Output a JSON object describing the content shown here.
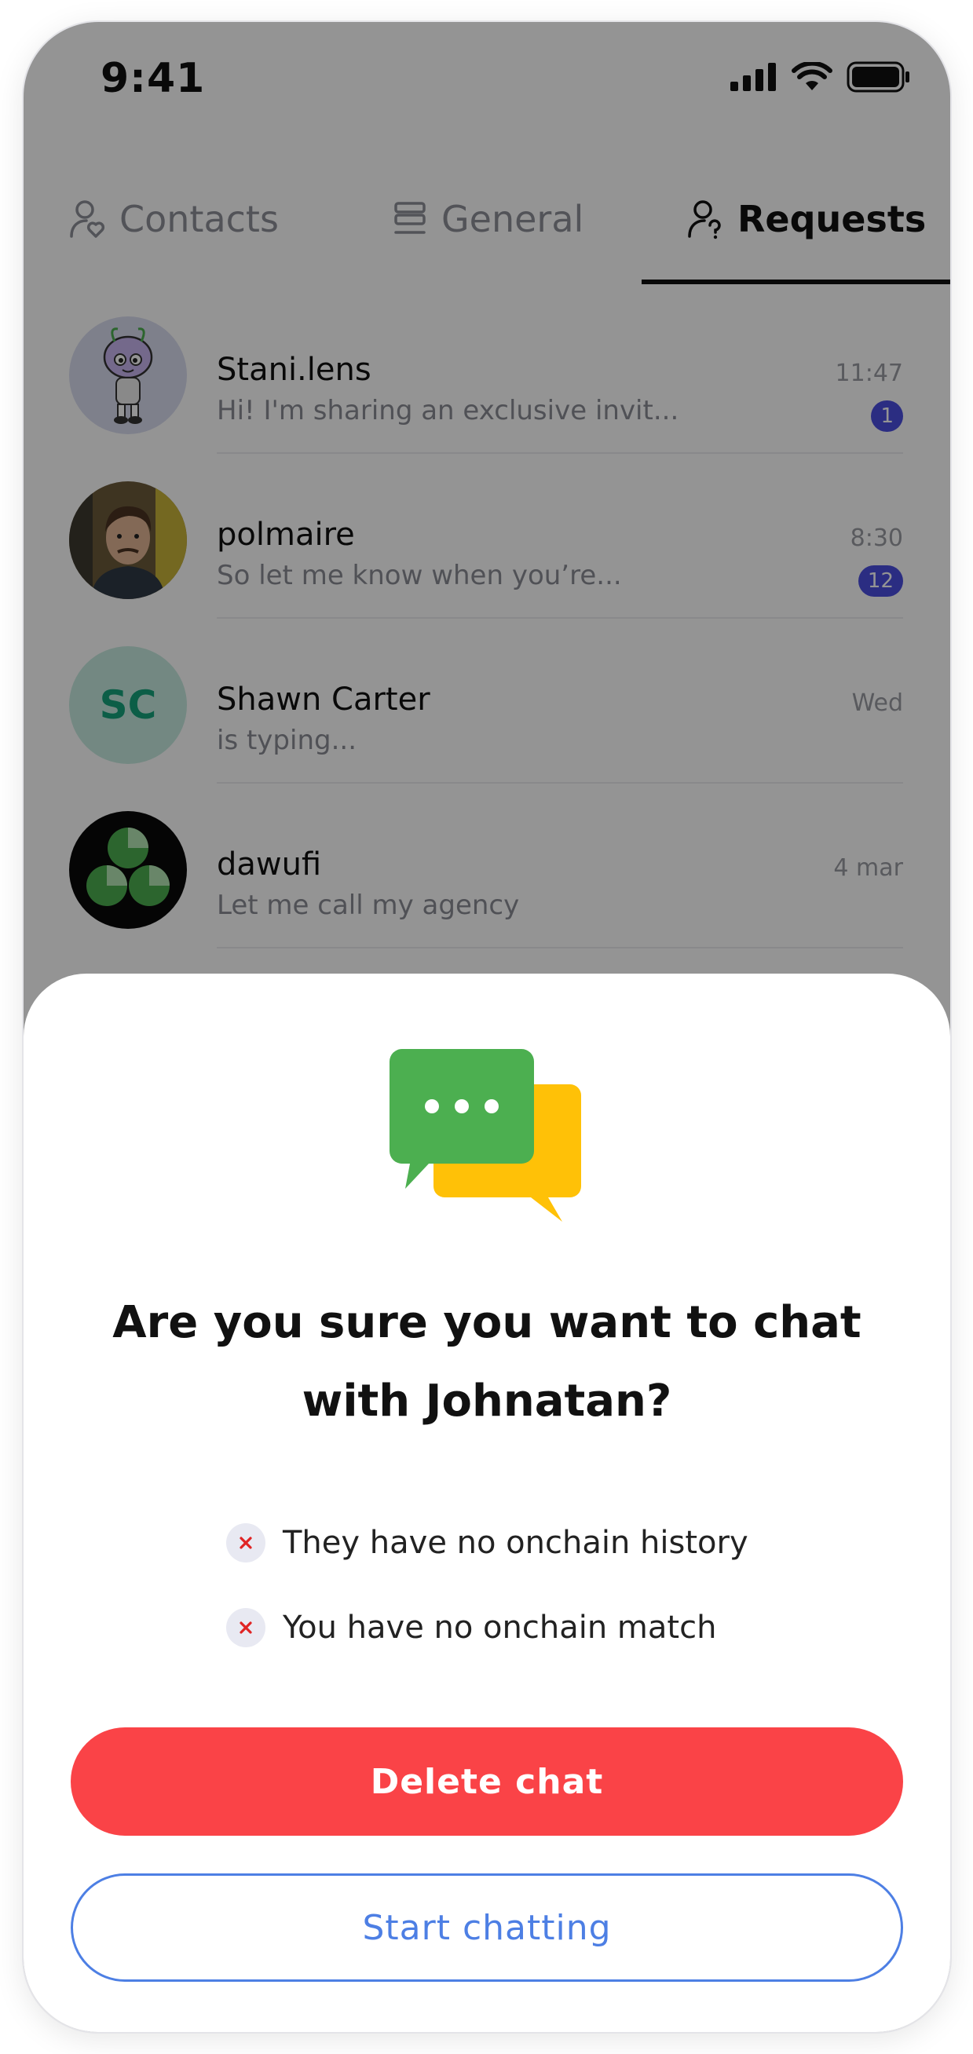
{
  "status_bar": {
    "time": "9:41"
  },
  "tabs": [
    {
      "label": "Contacts",
      "icon": "person-heart-icon",
      "active": false
    },
    {
      "label": "General",
      "icon": "stack-icon",
      "active": false
    },
    {
      "label": "Requests",
      "icon": "person-question-icon",
      "active": true
    }
  ],
  "chats": [
    {
      "name": "Stani.lens",
      "preview": "Hi! I'm sharing an exclusive invit...",
      "time": "11:47",
      "unread": "1",
      "avatar": "cartoon-avatar"
    },
    {
      "name": "polmaire",
      "preview": "So let me know when you’re...",
      "time": "8:30",
      "unread": "12",
      "avatar": "photo-avatar"
    },
    {
      "name": "Shawn Carter",
      "preview": "is typing...",
      "time": "Wed",
      "unread": "",
      "avatar_initials": "SC"
    },
    {
      "name": "dawufi",
      "preview": "Let me call my agency",
      "time": "4 mar",
      "unread": "",
      "avatar": "logo-avatar"
    }
  ],
  "sheet": {
    "illustration": "chat-bubbles-icon",
    "title_line1": "Are you sure you want to chat",
    "title_line2": "with Johnatan?",
    "reasons": [
      "They have no onchain history",
      "You have no onchain match"
    ],
    "delete_label": "Delete chat",
    "start_label": "Start chatting"
  },
  "colors": {
    "delete": "#fa4347",
    "start": "#4d7fe4",
    "unread_badge": "#4b4fe0",
    "bubble_green": "#4caf50",
    "bubble_yellow": "#ffc107"
  }
}
